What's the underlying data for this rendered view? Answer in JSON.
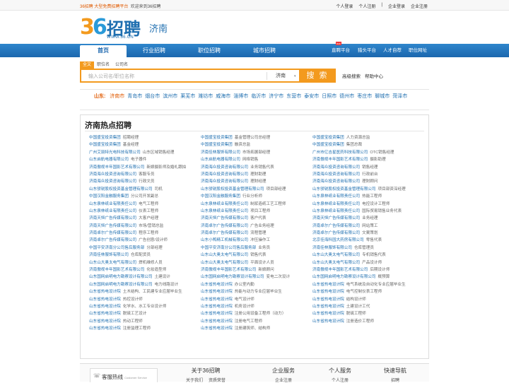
{
  "topbar": {
    "site": "36招聘",
    "slogan": "大型免费招聘平台",
    "welcome": "欢迎来到36招聘",
    "links": [
      "个人登录",
      "个人注册",
      "企业登录",
      "企业注册"
    ]
  },
  "header": {
    "logo_num_a": "3",
    "logo_num_b": "6",
    "logo_title": "招聘",
    "logo_www": "WWW.36.CN",
    "city": "济南"
  },
  "nav": {
    "items": [
      "首页",
      "行业招聘",
      "职位招聘",
      "城市招聘"
    ],
    "right": [
      "直聘平台",
      "猎头平台",
      "人才自荐",
      "职位网址"
    ],
    "badge": "hot"
  },
  "search": {
    "tabs": [
      "全文",
      "职位名",
      "公司名"
    ],
    "placeholder": "输入公司名/职位名称",
    "city": "济南",
    "button": "搜 索",
    "adv": "高级搜索",
    "help": "帮助中心"
  },
  "cities": {
    "province": "山东:",
    "items": [
      "济南市",
      "青岛市",
      "烟台市",
      "滨州市",
      "莱芜市",
      "潍坊市",
      "威海市",
      "淄博市",
      "临沂市",
      "济宁市",
      "东营市",
      "泰安市",
      "日照市",
      "德州市",
      "枣庄市",
      "聊城市",
      "菏泽市"
    ]
  },
  "panel": {
    "title": "济南热点招聘"
  },
  "jobs": [
    [
      [
        "中国盛宝投资集团",
        "招聘经理"
      ],
      [
        "中国盛宝投资集团",
        "基金管理公司总经理"
      ],
      [
        "中国盛宝投资集团",
        "人力资源总监"
      ]
    ],
    [
      [
        "中国盛宝投资集团",
        "基金经理"
      ],
      [
        "中国盛宝投资集团",
        "融资总监"
      ],
      [
        "中国盛宝投资集团",
        "集团总裁"
      ]
    ],
    [
      [
        "广州艾丽特光电科技有限公司",
        "山东区域销售经理"
      ],
      [
        "济南佳林服饰有限公司",
        "市场拓展部经理"
      ],
      [
        "广州市亿吉星医药科技有限公司",
        "OTC销售经理"
      ]
    ],
    [
      [
        "山东启航电器有限公司",
        "电子器件"
      ],
      [
        "山东启航电器有限公司",
        "网络销售"
      ],
      [
        "济南傲视丰年国影艺术有限公司",
        "摄影助理"
      ]
    ],
    [
      [
        "济南傲视丰年国影艺术有限公司",
        "新娘摄影师及婚礼跟拍"
      ],
      [
        "济南海众投资咨询有限公司",
        "业务销售代表"
      ],
      [
        "济南海众投资咨询有限公司",
        "销售经理"
      ]
    ],
    [
      [
        "济南海众投资咨询有限公司",
        "客服专员"
      ],
      [
        "济南海众投资咨询有限公司",
        "理财助理"
      ],
      [
        "济南海众投资咨询有限公司",
        "行政前台"
      ]
    ],
    [
      [
        "济南海众投资咨询有限公司",
        "行政文员"
      ],
      [
        "济南海众投资咨询有限公司",
        "理财经理"
      ],
      [
        "济南海众投资咨询有限公司",
        "理财顾问"
      ]
    ],
    [
      [
        "山东骄锐股权投资基金管理有限公司",
        "司机"
      ],
      [
        "山东骄锐股权投资基金管理有限公司",
        "项目部经理"
      ],
      [
        "山东骄锐股权投资基金管理有限公司",
        "项目部资深经理"
      ]
    ],
    [
      [
        "中国汉阳金融服务集团",
        "分公司开发副总"
      ],
      [
        "中国汉阳金融服务集团",
        "行业分析师"
      ],
      [
        "山东泉林纸业有限责任公司",
        "热能工程师"
      ]
    ],
    [
      [
        "山东泉林纸业有限责任公司",
        "电气工程师"
      ],
      [
        "山东泉林纸业有限责任公司",
        "制浆造纸工艺工程师"
      ],
      [
        "山东泉林纸业有限责任公司",
        "电控设计工程师"
      ]
    ],
    [
      [
        "山东泉林纸业有限责任公司",
        "仪表工程师"
      ],
      [
        "山东泉林纸业有限责任公司",
        "项目工程师"
      ],
      [
        "山东泉林纸业有限责任公司",
        "国际贸易销售业务代表"
      ]
    ],
    [
      [
        "济南天恒广告传媒有限公司",
        "大客户经理"
      ],
      [
        "济南天恒广告传媒有限公司",
        "客户代表"
      ],
      [
        "济南天恒广告传媒有限公司",
        "业务经理"
      ]
    ],
    [
      [
        "济南天恒广告传媒有限公司",
        "市场/营销总监"
      ],
      [
        "济南卓尔广告传媒有限公司",
        "广告业务经理"
      ],
      [
        "济南卓尔广告传媒有限公司",
        "网站策工"
      ]
    ],
    [
      [
        "济南卓尔广告传媒有限公司",
        "程序工程师"
      ],
      [
        "济南卓尔广告传媒有限公司",
        "流程管理"
      ],
      [
        "济南卓尔广告传媒有限公司",
        "文案策划"
      ]
    ],
    [
      [
        "济南卓尔广告传媒有限公司",
        "广告创意/设计师"
      ],
      [
        "山东小鸭精工机械有限公司",
        "冲压操作工"
      ],
      [
        "北京佳海科园大药房有限公司",
        "零售代表"
      ]
    ],
    [
      [
        "中国平安济南分公司售后服务部",
        "分部经理"
      ],
      [
        "中国平安济南分公司售后服务部",
        "业务员"
      ],
      [
        "济南佳林服饰有限公司",
        "仓库管理员"
      ]
    ],
    [
      [
        "济南佳林服饰有限公司",
        "仓库配货员"
      ],
      [
        "山东山大奥太电气有限公司",
        "销售代表"
      ],
      [
        "山东山大奥太电气有限公司",
        "专机销售代表"
      ]
    ],
    [
      [
        "山东山大奥太电气有限公司",
        "焊机维修人员"
      ],
      [
        "山东山大奥太电气有限公司",
        "平面设计人员"
      ],
      [
        "山东山大奥太电气有限公司",
        "产品设计师"
      ]
    ],
    [
      [
        "济南傲视丰年国影艺术有限公司",
        "化妆造型师"
      ],
      [
        "济南傲视丰年国影艺术有限公司",
        "新娘顾问"
      ],
      [
        "济南傲视丰年国影艺术有限公司",
        "后期设计师"
      ]
    ],
    [
      [
        "山东国网启明电力勘察设计有限公司",
        "土建设计"
      ],
      [
        "山东国网启明电力勘察设计有限公司",
        "变电二次设计"
      ],
      [
        "山东国网启明电力勘察设计有限公司",
        "概预算"
      ]
    ],
    [
      [
        "山东国网启明电力勘察设计有限公司",
        "电力线路设计"
      ],
      [
        "山东省热电设计院",
        "办公室内勤"
      ],
      [
        "山东省热电设计院",
        "电气系统及自动化专业应届毕业生"
      ]
    ],
    [
      [
        "山东省热电设计院",
        "土木结构、工民建专业应届毕业生"
      ],
      [
        "山东省热电设计院",
        "热能与动力专业应届毕业生"
      ],
      [
        "山东省热电设计院",
        "电气控制仪表工程师"
      ]
    ],
    [
      [
        "山东省热电设计院",
        "热控设计师"
      ],
      [
        "山东省热电设计院",
        "电气设计师"
      ],
      [
        "山东省热电设计院",
        "结构设计师"
      ]
    ],
    [
      [
        "山东省热电设计院",
        "化学水、水工专业设计师"
      ],
      [
        "山东省热电设计院",
        "机务设计师"
      ],
      [
        "山东省热电设计院",
        "土建设计工代"
      ]
    ],
    [
      [
        "山东省热电设计院",
        "脱硫工艺设计"
      ],
      [
        "山东省热电设计院",
        "注册公用设备工程师（动力）"
      ],
      [
        "山东省热电设计院",
        "脱硫工程师"
      ]
    ],
    [
      [
        "山东省热电设计院",
        "热动工程师"
      ],
      [
        "山东省热电设计院",
        "注册电气工程师"
      ],
      [
        "山东省热电设计院",
        "注册造价工程师"
      ]
    ],
    [
      [
        "山东省热电设计院",
        "注册监理工程师"
      ],
      [
        "山东省热电设计院",
        "注册建筑师、结构师"
      ]
    ]
  ],
  "footer": {
    "hotline": "客服热线",
    "hotline_en": "Customer Service",
    "cols": [
      {
        "h": "关于36招聘",
        "s": [
          "关于我们",
          "资质荣誉"
        ]
      },
      {
        "h": "企业服务",
        "s": [
          "企业注册"
        ]
      },
      {
        "h": "个人服务",
        "s": [
          "个人注册"
        ]
      },
      {
        "h": "快速导航",
        "s": [
          "招聘"
        ]
      }
    ]
  }
}
